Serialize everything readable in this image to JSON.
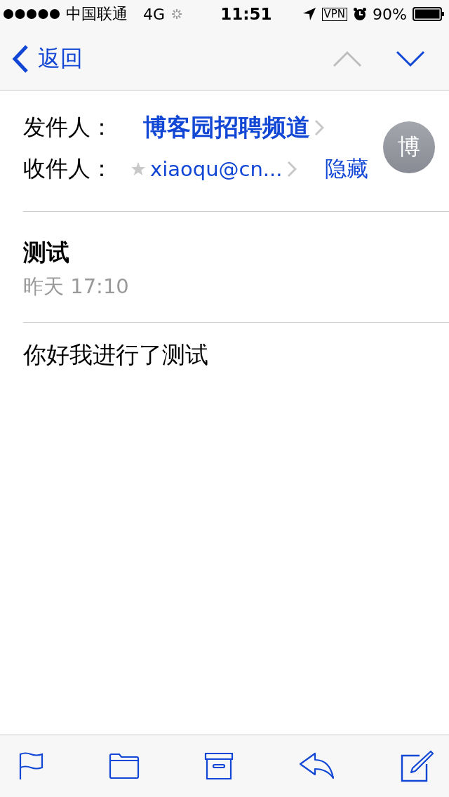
{
  "status_bar": {
    "carrier": "中国联通",
    "network": "4G",
    "time": "11:51",
    "vpn": "VPN",
    "battery": "90%"
  },
  "nav": {
    "back": "返回",
    "previous": {
      "disabled": true
    },
    "next": {
      "disabled": false
    }
  },
  "header": {
    "from_label": "发件人：",
    "from": "博客园招聘频道",
    "to_label": "收件人：",
    "to": "xiaoqu@cn...",
    "hide": "隐藏",
    "avatar": "博"
  },
  "message": {
    "subject": "测试",
    "date": "昨天 17:10",
    "body": "你好我进行了测试"
  }
}
